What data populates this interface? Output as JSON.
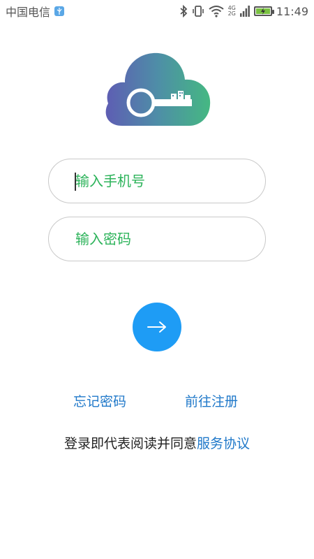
{
  "status_bar": {
    "carrier": "中国电信",
    "net_top": "4G",
    "net_bottom": "2G",
    "time": "11:49"
  },
  "login": {
    "phone_placeholder": "输入手机号",
    "password_placeholder": "输入密码",
    "forgot_password": "忘记密码",
    "register": "前往注册",
    "agreement_prefix": "登录即代表阅读并同意",
    "agreement_link": "服务协议"
  },
  "colors": {
    "placeholder_green": "#2cb35a",
    "link_blue": "#1f78c9",
    "button_blue": "#1e9cf5"
  },
  "icons": {
    "logo": "cloud-key-icon",
    "submit": "arrow-right-icon"
  }
}
